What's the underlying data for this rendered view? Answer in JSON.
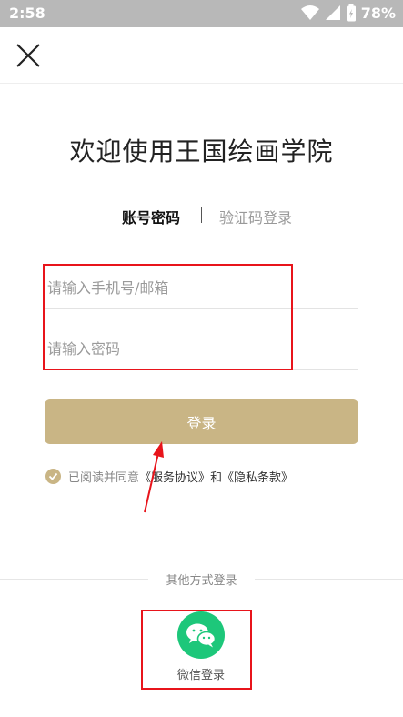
{
  "status_bar": {
    "time": "2:58",
    "battery_percent": "78%",
    "icons": [
      "wifi-icon",
      "signal-icon",
      "battery-icon"
    ]
  },
  "header": {
    "close_icon": "close-icon"
  },
  "title": "欢迎使用王国绘画学院",
  "tabs": {
    "password_login": "账号密码",
    "code_login": "验证码登录"
  },
  "form": {
    "phone_placeholder": "请输入手机号/邮箱",
    "phone_value": "",
    "password_placeholder": "请输入密码",
    "password_value": ""
  },
  "login_button": "登录",
  "agreement": {
    "prefix": "已阅读并同意",
    "service_link": "《服务协议》",
    "and": "和",
    "privacy_link": "《隐私条款》"
  },
  "other_login": {
    "label": "其他方式登录",
    "wechat_label": "微信登录"
  },
  "colors": {
    "accent_gold": "#c9b585",
    "wechat_green": "#1dc77a",
    "highlight_red": "#e8141b",
    "status_bar": "#b8b8b8"
  }
}
